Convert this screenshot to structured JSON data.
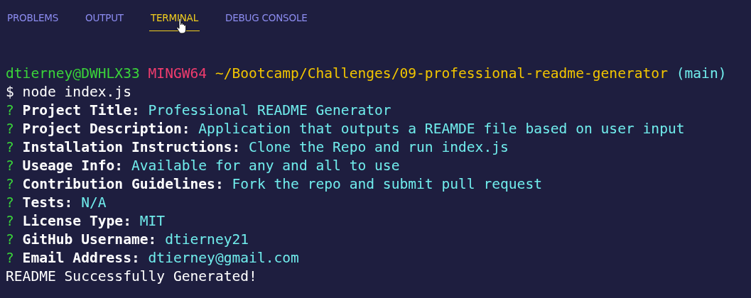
{
  "tabs": [
    {
      "label": "PROBLEMS",
      "selected": false
    },
    {
      "label": "OUTPUT",
      "selected": false
    },
    {
      "label": "TERMINAL",
      "selected": true
    },
    {
      "label": "DEBUG CONSOLE",
      "selected": false
    }
  ],
  "terminal": {
    "prompt": {
      "user_host": "dtierney@DWHLX33",
      "system": "MINGW64",
      "path": "~/Bootcamp/Challenges/09-professional-readme-generator",
      "branch": "(main)"
    },
    "command": {
      "symbol": "$",
      "text": "node index.js"
    },
    "questions": [
      {
        "marker": "?",
        "label": "Project Title:",
        "answer": "Professional README Generator"
      },
      {
        "marker": "?",
        "label": "Project Description:",
        "answer": "Application that outputs a REAMDE file based on user input"
      },
      {
        "marker": "?",
        "label": "Installation Instructions:",
        "answer": "Clone the Repo and run index.js"
      },
      {
        "marker": "?",
        "label": "Useage Info:",
        "answer": "Available for any and all to use"
      },
      {
        "marker": "?",
        "label": "Contribution Guidelines:",
        "answer": "Fork the repo and submit pull request"
      },
      {
        "marker": "?",
        "label": "Tests:",
        "answer": "N/A"
      },
      {
        "marker": "?",
        "label": "License Type:",
        "answer": "MIT"
      },
      {
        "marker": "?",
        "label": "GitHub Username:",
        "answer": "dtierney21"
      },
      {
        "marker": "?",
        "label": "Email Address:",
        "answer": "dtierney@gmail.com"
      }
    ],
    "output": "README Successfully Generated!"
  }
}
